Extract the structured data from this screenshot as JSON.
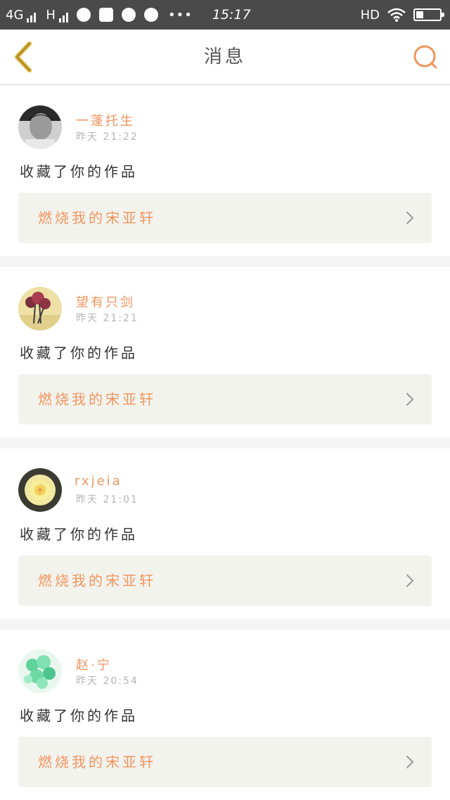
{
  "status_bar": {
    "network": "4G",
    "network2": "H",
    "time": "15:17",
    "hd": "HD",
    "battery_level": 0.3
  },
  "navbar": {
    "title": "消息",
    "back_icon": "chevron-left-icon",
    "search_icon": "search-icon",
    "accent_color": "#f1955e",
    "back_color": "#d9b13a"
  },
  "messages": [
    {
      "name": "一蓬托生",
      "time": "昨天 21:22",
      "action": "收藏了你的作品",
      "work": "燃烧我的宋亚轩"
    },
    {
      "name": "望有只剑",
      "time": "昨天 21:21",
      "action": "收藏了你的作品",
      "work": "燃烧我的宋亚轩"
    },
    {
      "name": "rxjeia",
      "time": "昨天 21:01",
      "action": "收藏了你的作品",
      "work": "燃烧我的宋亚轩"
    },
    {
      "name": "赵·宁",
      "time": "昨天 20:54",
      "action": "收藏了你的作品",
      "work": "燃烧我的宋亚轩"
    }
  ]
}
